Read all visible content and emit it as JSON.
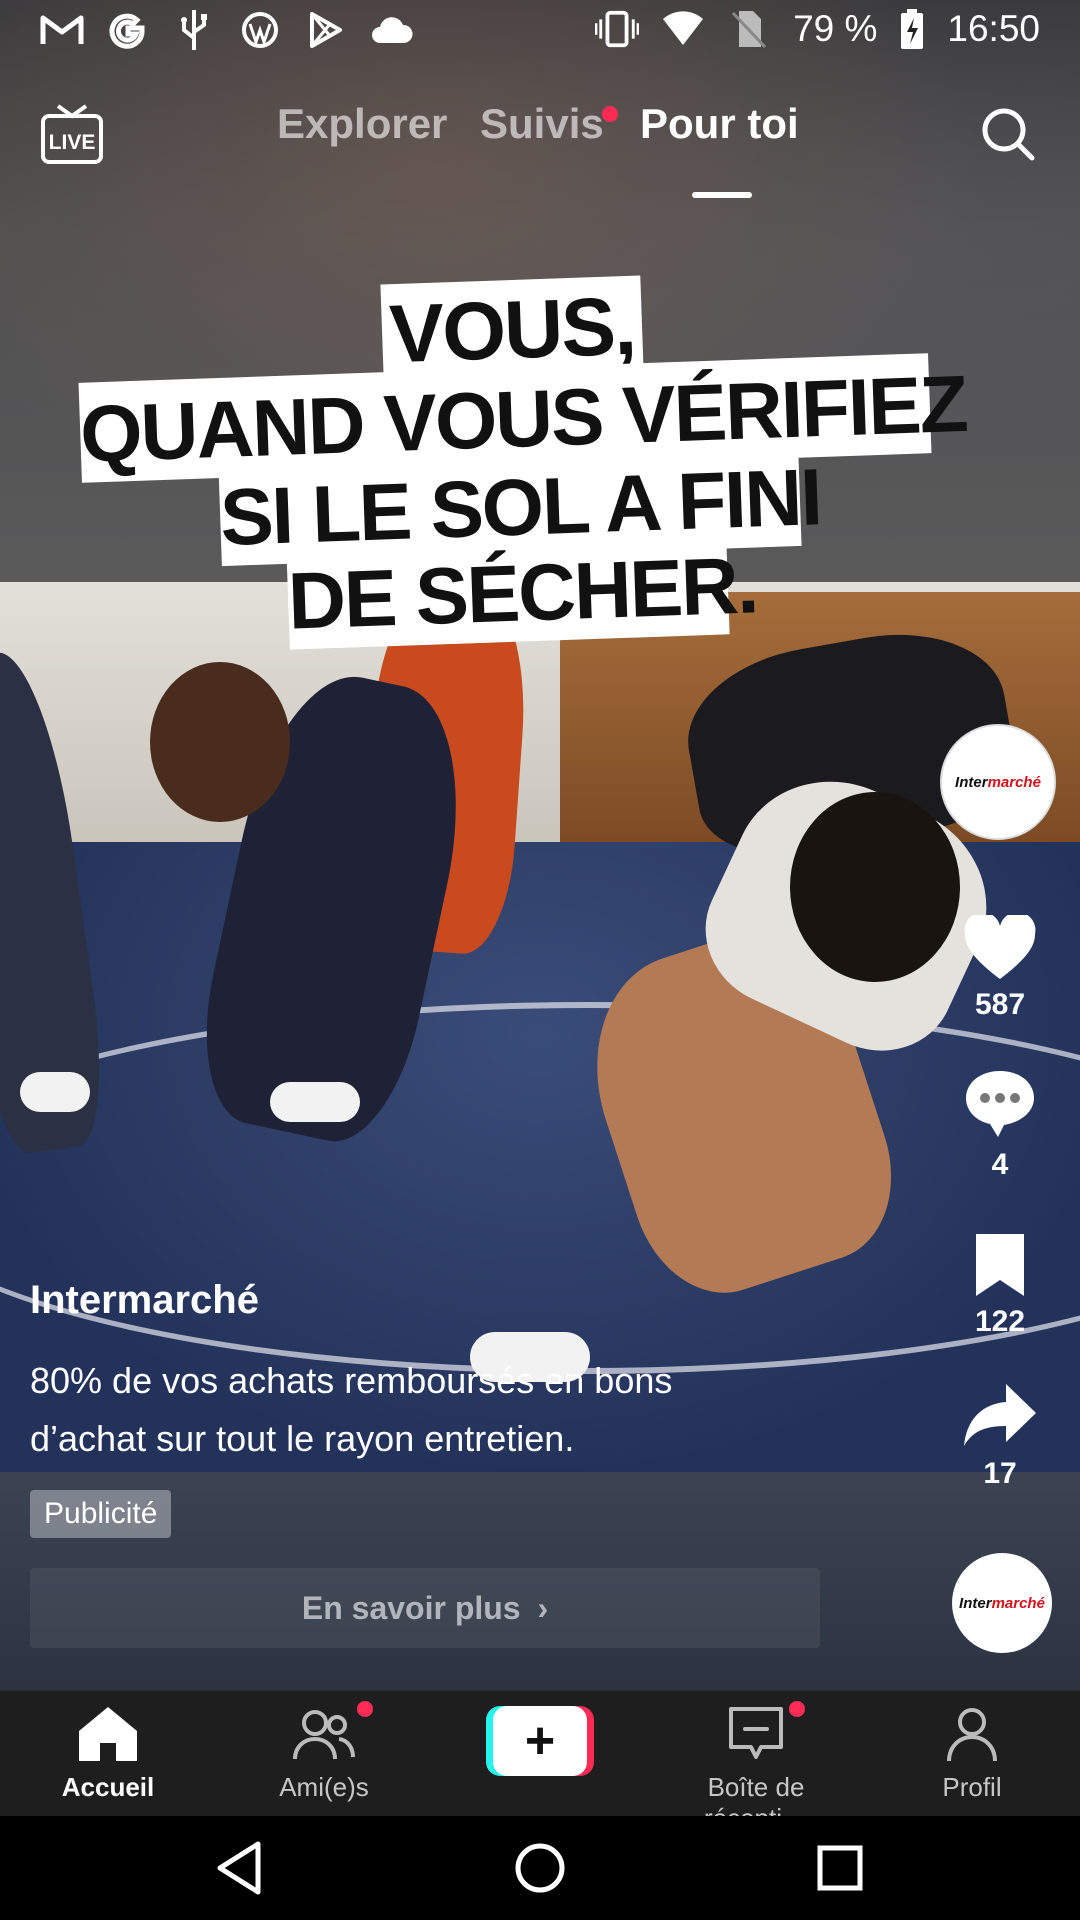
{
  "status_bar": {
    "battery": "79 %",
    "time": "16:50",
    "icons_left": [
      "gmail-icon",
      "google-icon",
      "usb-icon",
      "wordpress-icon",
      "play-store-icon",
      "cloud-icon"
    ],
    "icons_right": [
      "vibrate-icon",
      "wifi-icon",
      "no-sim-icon",
      "battery-charging-icon"
    ]
  },
  "top_nav": {
    "live_label": "LIVE",
    "tabs": [
      {
        "label": "Explorer",
        "active": false
      },
      {
        "label": "Suivis",
        "active": false,
        "has_notification_dot": true
      },
      {
        "label": "Pour toi",
        "active": true
      }
    ]
  },
  "video": {
    "caption_lines": [
      "VOUS,",
      "QUAND VOUS VÉRIFIEZ",
      "SI LE SOL A FINI",
      "DE SÉCHER."
    ]
  },
  "rail": {
    "brand_logo": {
      "prefix": "Inter",
      "suffix": "marché"
    },
    "likes": "587",
    "comments": "4",
    "bookmarks": "122",
    "shares": "17"
  },
  "post": {
    "author": "Intermarché",
    "description": "80% de vos achats remboursés en bons d’achat sur tout le rayon entretien.",
    "ad_badge": "Publicité",
    "cta_label": "En savoir plus",
    "cta_chevron": "›"
  },
  "tab_bar": {
    "items": [
      {
        "label": "Accueil",
        "icon": "home-icon",
        "active": true
      },
      {
        "label": "Ami(e)s",
        "icon": "friends-icon",
        "has_notification_dot": true
      },
      {
        "label": "",
        "icon": "plus-icon"
      },
      {
        "label": "Boîte de récepti…",
        "icon": "inbox-icon",
        "has_notification_dot": true
      },
      {
        "label": "Profil",
        "icon": "profile-icon"
      }
    ],
    "create_symbol": "+"
  },
  "colors": {
    "accent_red": "#fe2c55",
    "accent_cyan": "#25f4ee",
    "tab_bar_bg": "#1e1e1e"
  }
}
